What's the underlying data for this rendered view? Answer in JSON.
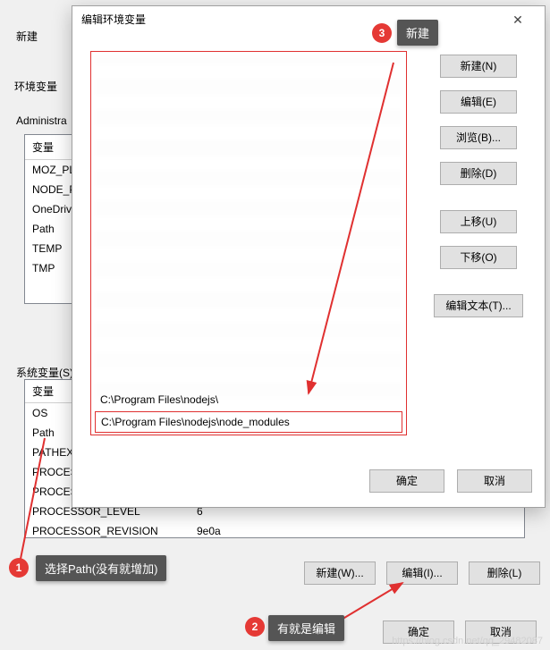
{
  "back_dialog": {
    "xinjian": "新建",
    "env_label": "环境变量",
    "admin_label": "Administra",
    "user_vars_header": "变量",
    "user_vars": [
      "MOZ_PL",
      "NODE_P",
      "OneDriv",
      "Path",
      "TEMP",
      "TMP"
    ],
    "sys_label": "系统变量(S)",
    "sys_header": "变量",
    "sys_vars": [
      {
        "name": "OS",
        "value": ""
      },
      {
        "name": "Path",
        "value": ""
      },
      {
        "name": "PATHEXT",
        "value": ""
      },
      {
        "name": "PROCESSOR",
        "value": ""
      },
      {
        "name": "PROCESSOR",
        "value": ""
      },
      {
        "name": "PROCESSOR_LEVEL",
        "value": "6"
      },
      {
        "name": "PROCESSOR_REVISION",
        "value": "9e0a"
      }
    ],
    "buttons_row1": {
      "new": "新建(W)...",
      "edit": "编辑(I)...",
      "delete": "删除(L)"
    },
    "buttons_row2": {
      "ok": "确定",
      "cancel": "取消"
    }
  },
  "modal": {
    "title": "编辑环境变量",
    "visible_paths": [
      "C:\\Program Files\\nodejs\\",
      "C:\\Program Files\\nodejs\\node_modules"
    ],
    "buttons": {
      "new": "新建(N)",
      "edit": "编辑(E)",
      "browse": "浏览(B)...",
      "delete": "删除(D)",
      "move_up": "上移(U)",
      "move_down": "下移(O)",
      "edit_text": "编辑文本(T)...",
      "ok": "确定",
      "cancel": "取消"
    }
  },
  "annotations": {
    "c1": {
      "num": "1",
      "label": "选择Path(没有就增加)"
    },
    "c2": {
      "num": "2",
      "label": "有就是编辑"
    },
    "c3": {
      "num": "3",
      "label": "新建"
    }
  },
  "watermark": "https://blog.csdn.net/qq_29482087"
}
